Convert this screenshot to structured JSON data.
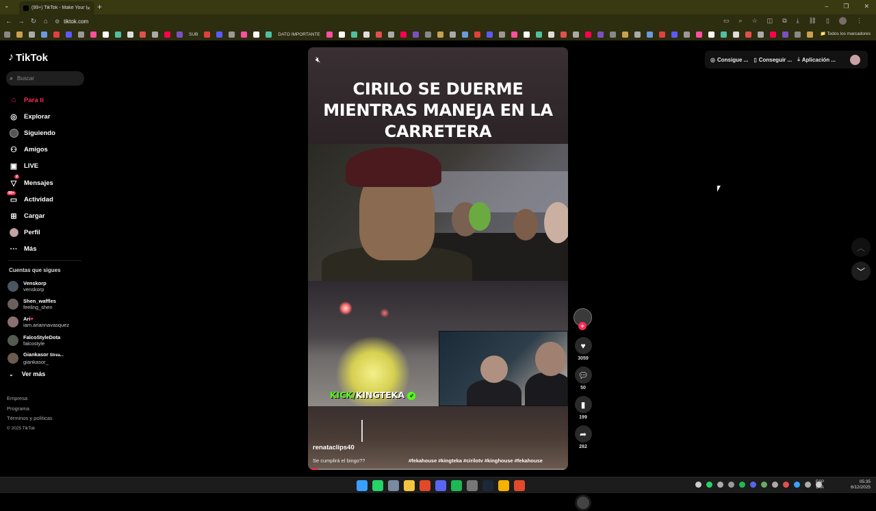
{
  "browser": {
    "tab_title": "(99+) TikTok - Make Your Day",
    "url": "tiktok.com",
    "bookmarks_important_label": "DATO IMPORTANTE",
    "bookmarks_sub_label": "SUB",
    "all_bookmarks_label": "Todos los marcadores"
  },
  "sidebar": {
    "logo": "TikTok",
    "search_placeholder": "Buscar",
    "nav": [
      {
        "label": "Para ti",
        "icon": "home-icon"
      },
      {
        "label": "Explorar",
        "icon": "compass-icon"
      },
      {
        "label": "Siguiendo",
        "icon": "following-icon"
      },
      {
        "label": "Amigos",
        "icon": "friends-icon"
      },
      {
        "label": "LIVE",
        "icon": "live-icon"
      },
      {
        "label": "Mensajes",
        "icon": "messages-icon",
        "badge": "2"
      },
      {
        "label": "Actividad",
        "icon": "activity-icon",
        "badge": "99+"
      },
      {
        "label": "Cargar",
        "icon": "upload-icon"
      },
      {
        "label": "Perfil",
        "icon": "profile-icon"
      },
      {
        "label": "Más",
        "icon": "more-icon"
      }
    ],
    "following_title": "Cuentas que sigues",
    "following": [
      {
        "name": "Venskorp",
        "user": "venskorp"
      },
      {
        "name": "Shen_waffles",
        "user": "feeling_shen"
      },
      {
        "name": "Ari",
        "user": "iam.ariannavasquez"
      },
      {
        "name": "FalcoStyleDota",
        "user": "falcostyle"
      },
      {
        "name": "Giankasor",
        "user": "giankasor_",
        "tag": "Strea..."
      }
    ],
    "see_more": "Ver más",
    "footer": [
      "Empresa",
      "Programa",
      "Términos y políticas"
    ],
    "copyright": "© 2025 TikTok"
  },
  "video": {
    "caption": "CIRILO SE DUERME MIENTRAS MANEJA EN LA CARRETERA",
    "overlay_kick": "KICK/",
    "overlay_channel": "KINGTEKA",
    "author": "renataclips40",
    "description": "Se cumplirá el bingo??",
    "hashtags": "#fekahouse #kingteka #cirilotv #kinghouse #fekahouse",
    "progress": 0.04
  },
  "actions": {
    "likes": "3059",
    "comments": "50",
    "saves": "199",
    "shares": "282"
  },
  "topright": {
    "coins": "Consigue ...",
    "get": "Conseguir ...",
    "app": "Aplicación ..."
  },
  "taskbar": {
    "lang1": "ESP",
    "lang2": "LAA",
    "time": "05:35",
    "date": "6/12/2025"
  },
  "colors": {
    "accent": "#fe2c55",
    "kick_green": "#53fc18"
  }
}
